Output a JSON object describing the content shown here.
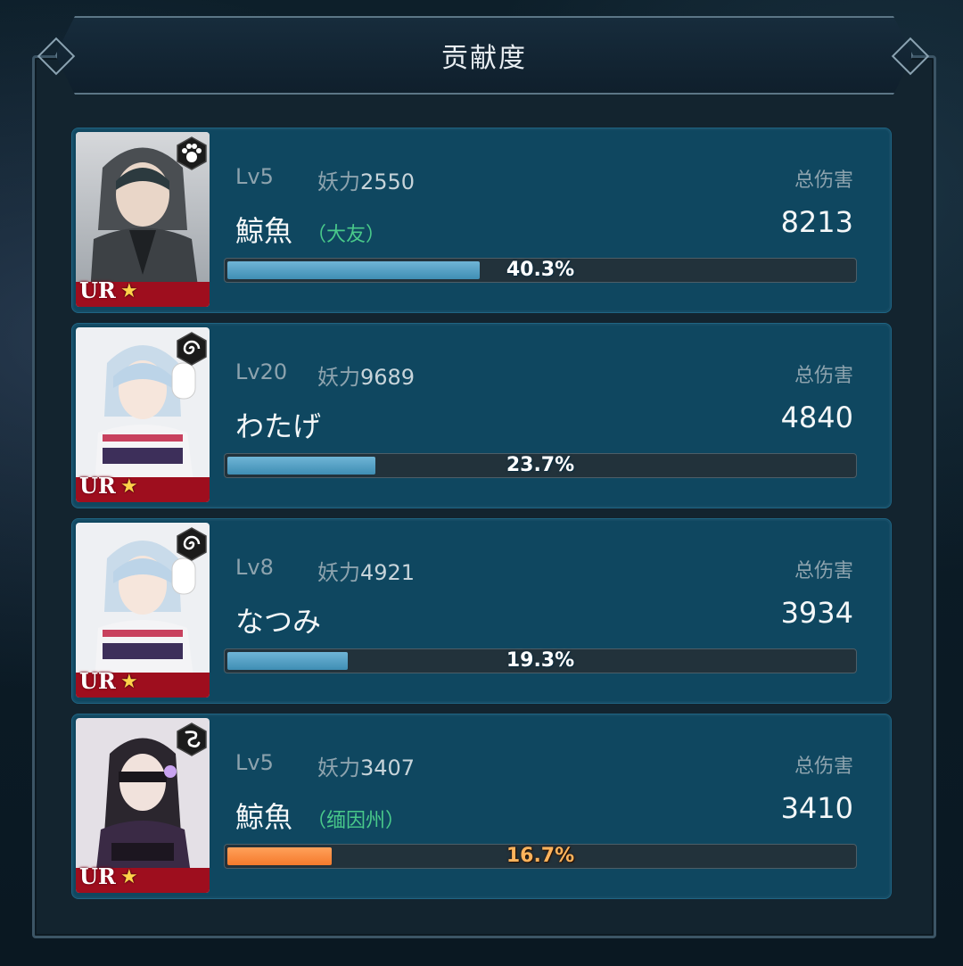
{
  "title": "贡献度",
  "entries": [
    {
      "level": "Lv5",
      "power_label": "妖力",
      "power_value": "2550",
      "name": "鯨魚",
      "guild": "（大友）",
      "damage_label": "总伤害",
      "damage_value": "8213",
      "percent": 40.3,
      "percent_label": "40.3%",
      "rarity": "UR",
      "faction_icon": "paw-icon",
      "bar_color": "#4a9cc3"
    },
    {
      "level": "Lv20",
      "power_label": "妖力",
      "power_value": "9689",
      "name": "わたげ",
      "guild": "",
      "damage_label": "总伤害",
      "damage_value": "4840",
      "percent": 23.7,
      "percent_label": "23.7%",
      "rarity": "UR",
      "faction_icon": "spiral-icon",
      "bar_color": "#4a9cc3"
    },
    {
      "level": "Lv8",
      "power_label": "妖力",
      "power_value": "4921",
      "name": "なつみ",
      "guild": "",
      "damage_label": "总伤害",
      "damage_value": "3934",
      "percent": 19.3,
      "percent_label": "19.3%",
      "rarity": "UR",
      "faction_icon": "spiral-icon",
      "bar_color": "#4a9cc3"
    },
    {
      "level": "Lv5",
      "power_label": "妖力",
      "power_value": "3407",
      "name": "鯨魚",
      "guild": "（缅因州）",
      "damage_label": "总伤害",
      "damage_value": "3410",
      "percent": 16.7,
      "percent_label": "16.7%",
      "rarity": "UR",
      "faction_icon": "serpent-icon",
      "bar_color": "#f57a2c"
    }
  ],
  "star_glyph": "★"
}
